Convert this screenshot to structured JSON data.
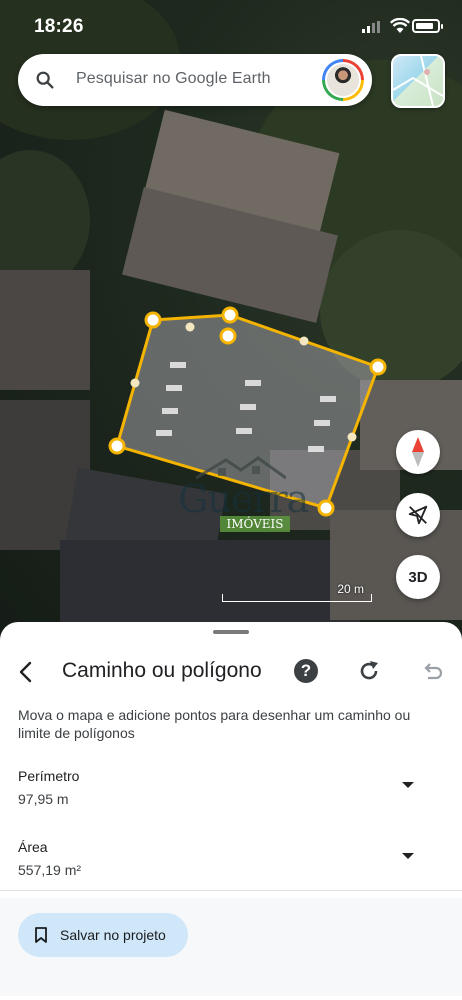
{
  "status_bar": {
    "time": "18:26"
  },
  "search": {
    "placeholder": "Pesquisar no Google Earth"
  },
  "watermark": {
    "name": "Guerra",
    "subtitle": "IMÓVEIS"
  },
  "map_controls": {
    "three_d_label": "3D"
  },
  "scale_bar": {
    "label": "20 m"
  },
  "colors": {
    "polygon_stroke": "#f4b400",
    "sheet_bg": "#ffffff",
    "save_button_bg": "#cfe7f9"
  },
  "sheet": {
    "title": "Caminho ou polígono",
    "help_label": "?",
    "instruction": "Mova o mapa e adicione pontos para desenhar um caminho ou limite de polígonos",
    "metrics": [
      {
        "label": "Perímetro",
        "value": "97,95 m"
      },
      {
        "label": "Área",
        "value": "557,19 m²"
      }
    ],
    "save_button": "Salvar no projeto"
  },
  "icons": [
    "search-icon",
    "profile-avatar",
    "map-layer-thumbnail",
    "compass-icon",
    "location-off-icon",
    "back-arrow-icon",
    "help-icon",
    "redo-icon",
    "undo-icon",
    "bookmark-icon",
    "chevron-down-icon"
  ]
}
